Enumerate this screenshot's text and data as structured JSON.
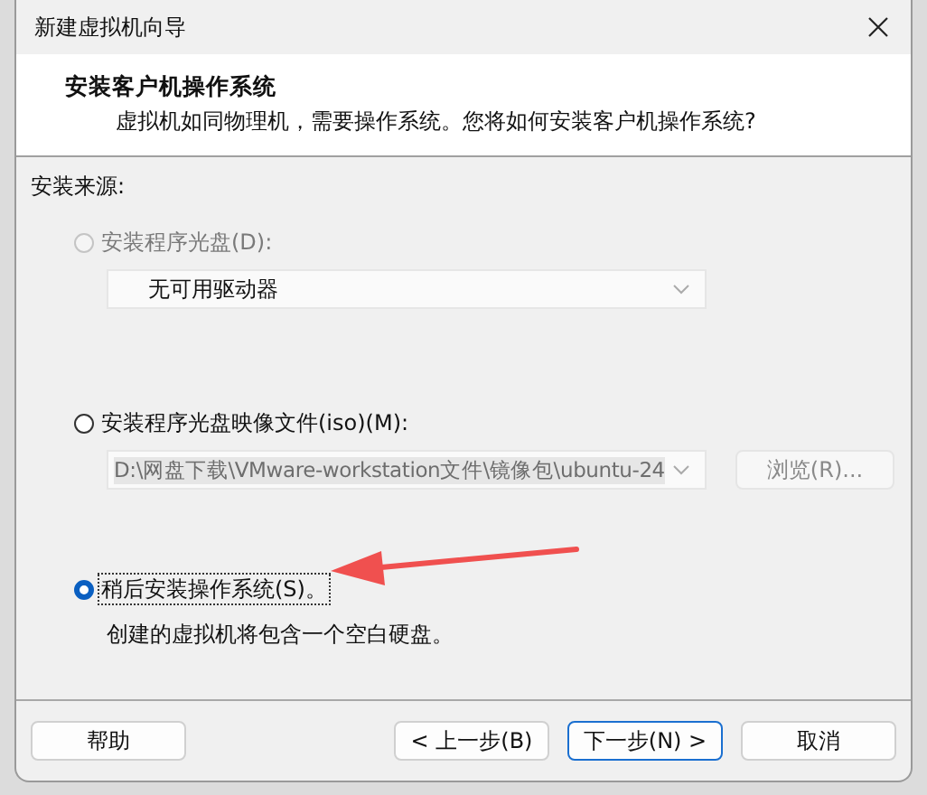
{
  "window": {
    "title": "新建虚拟机向导"
  },
  "header": {
    "title": "安装客户机操作系统",
    "subtitle": "虚拟机如同物理机，需要操作系统。您将如何安装客户机操作系统?"
  },
  "source_label": "安装来源:",
  "options": [
    {
      "kind": "disc",
      "label": "安装程序光盘(D):",
      "selected": false,
      "disabled": true,
      "dropdown": {
        "value": "无可用驱动器",
        "disabled": true
      }
    },
    {
      "kind": "iso",
      "label": "安装程序光盘映像文件(iso)(M):",
      "selected": false,
      "disabled": false,
      "path": {
        "value": "D:\\网盘下载\\VMware-workstation文件\\镜像包\\ubuntu-24",
        "disabled": true
      },
      "browse": {
        "label": "浏览(R)...",
        "disabled": true
      }
    },
    {
      "kind": "later",
      "label": "稍后安装操作系统(S)。",
      "selected": true,
      "disabled": false,
      "note": "创建的虚拟机将包含一个空白硬盘。"
    }
  ],
  "buttons": [
    {
      "label": "帮助",
      "default": false
    },
    {
      "label": "< 上一步(B)",
      "default": false
    },
    {
      "label": "下一步(N) >",
      "default": true
    },
    {
      "label": "取消",
      "default": false
    }
  ]
}
